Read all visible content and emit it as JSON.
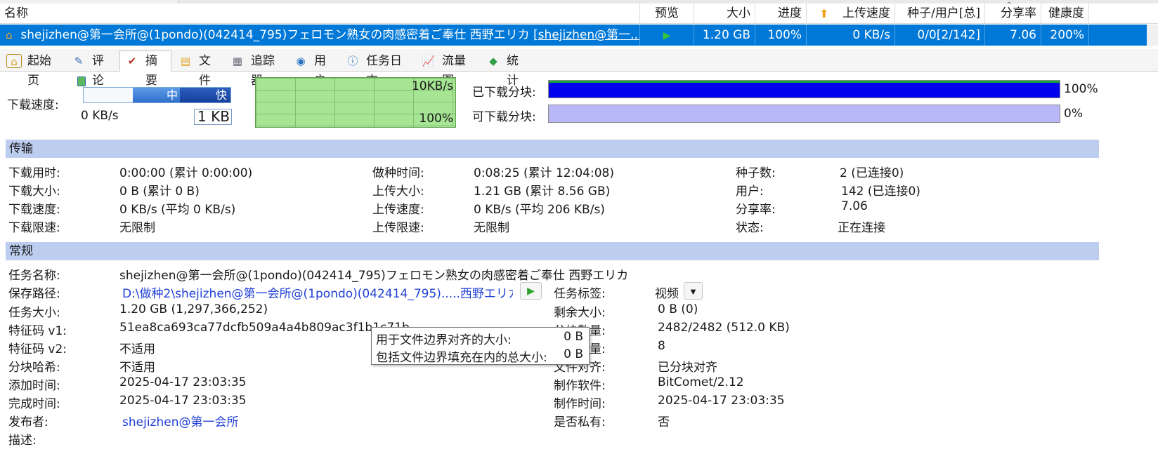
{
  "list": {
    "headers": [
      "名称",
      "预览",
      "大小",
      "进度",
      "上传速度",
      "种子/用户[总]",
      "分享率",
      "健康度"
    ],
    "row": {
      "name": "shejizhen@第一会所@(1pondo)(042414_795)フェロモン熟女の肉感密着ご奉仕 西野エリカ ",
      "name_link": "[shejizhen@第一...",
      "size": "1.20 GB",
      "progress": "100%",
      "upload_speed": "0 KB/s",
      "seeds_users": "0/0[2/142]",
      "share_ratio": "7.06",
      "health": "200%"
    }
  },
  "tabs": [
    {
      "label": "起始页",
      "icon": "home-icon"
    },
    {
      "label": "评论",
      "icon": "comment-icon"
    },
    {
      "label": "摘要",
      "icon": "summary-icon"
    },
    {
      "label": "文件",
      "icon": "file-icon"
    },
    {
      "label": "追踪器",
      "icon": "tracker-icon"
    },
    {
      "label": "用户",
      "icon": "users-icon"
    },
    {
      "label": "任务日志",
      "icon": "info-icon"
    },
    {
      "label": "流量图",
      "icon": "chart-icon"
    },
    {
      "label": "统计",
      "icon": "stats-icon"
    }
  ],
  "speed": {
    "label": "下载速度:",
    "current": "0 KB/s",
    "mid": "中",
    "fast": "快",
    "limit_value": "1 KB",
    "graph_max": "10KB/s",
    "graph_pct": "100%"
  },
  "pieces": {
    "downloaded_label": "已下载分块:",
    "downloaded_value": "100%",
    "downloaded_fraction": 1.0,
    "available_label": "可下载分块:",
    "available_value": "0%",
    "available_fraction": 0.0
  },
  "transfer": {
    "title": "传输",
    "rows": [
      {
        "k1": "下载用时:",
        "v1": "0:00:00 (累计 0:00:00)",
        "k2": "做种时间:",
        "v2": "0:08:25 (累计 12:04:08)",
        "k3": "种子数:",
        "v3": "2 (已连接0)"
      },
      {
        "k1": "下载大小:",
        "v1": "0 B (累计 0 B)",
        "k2": "上传大小:",
        "v2": "1.21 GB (累计 8.56 GB)",
        "k3": "用户:",
        "v3": "142 (已连接0)"
      },
      {
        "k1": "下载速度:",
        "v1": "0 KB/s (平均 0 KB/s)",
        "k2": "上传速度:",
        "v2": "0 KB/s (平均 206 KB/s)",
        "k3": "分享率:",
        "v3": "7.06"
      },
      {
        "k1": "下载限速:",
        "v1": "无限制",
        "k2": "上传限速:",
        "v2": "无限制",
        "k3": "状态:",
        "v3": "正在连接"
      }
    ]
  },
  "general": {
    "title": "常规",
    "task_name_label": "任务名称:",
    "task_name": "shejizhen@第一会所@(1pondo)(042414_795)フェロモン熟女の肉感密着ご奉仕 西野エリカ",
    "save_path_label": "保存路径:",
    "save_path": "D:\\做种2\\shejizhen@第一会所@(1pondo)(042414_795).....西野エリカ",
    "task_size_label": "任务大小:",
    "task_size": "1.20 GB (1,297,366,252)",
    "hash_v1_label": "特征码 v1:",
    "hash_v1": "51ea8ca693ca77dcfb509a4a4b809ac3f1b1c71b",
    "hash_v2_label": "特征码 v2:",
    "hash_v2": "不适用",
    "piece_hash_label": "分块哈希:",
    "piece_hash": "不适用",
    "added_label": "添加时间:",
    "added": "2025-04-17 23:03:35",
    "completed_label": "完成时间:",
    "completed": "2025-04-17 23:03:35",
    "publisher_label": "发布者:",
    "publisher": "shejizhen@第一会所",
    "desc_label": "描述:",
    "tag_label": "任务标签:",
    "tag": "视频",
    "remaining_label": "剩余大小:",
    "remaining": "0 B (0)",
    "piece_count_label": "分块数量:",
    "piece_count": "2482/2482 (512.0 KB)",
    "file_count_label": "文件数量:",
    "file_count": "8",
    "align_label": "文件对齐:",
    "align": "已分块对齐",
    "software_label": "制作软件:",
    "software": "BitComet/2.12",
    "made_time_label": "制作时间:",
    "made_time": "2025-04-17 23:03:35",
    "private_label": "是否私有:",
    "private": "否"
  },
  "tooltip": {
    "row1_label": "用于文件边界对齐的大小:",
    "row1_value": "0 B",
    "row2_label": "包括文件边界填充在内的总大小:",
    "row2_value": "0 B"
  },
  "colors": {
    "selection": "#0078d7",
    "downloaded_bar": "#0000ee",
    "available_bar": "#b8b8f8",
    "section_header": "#bdcdef",
    "graph_bg": "#a6e594",
    "link": "#1f3fd6"
  }
}
